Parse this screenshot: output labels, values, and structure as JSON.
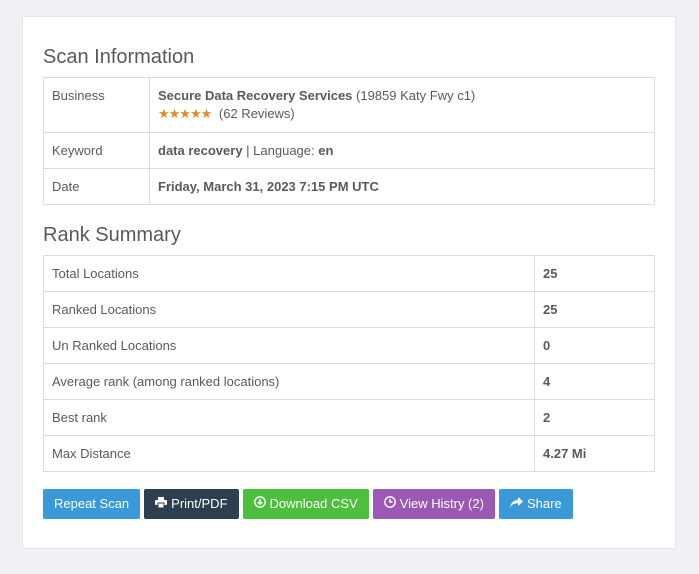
{
  "scan_info": {
    "title": "Scan Information",
    "business_label": "Business",
    "business_name": "Secure Data Recovery Services",
    "business_address": "(19859 Katy Fwy c1)",
    "rating_stars": "★★★★★",
    "reviews": "(62 Reviews)",
    "keyword_label": "Keyword",
    "keyword": "data recovery",
    "language_sep": " | Language: ",
    "language": "en",
    "date_label": "Date",
    "date": "Friday, March 31, 2023 7:15 PM UTC"
  },
  "rank_summary": {
    "title": "Rank Summary",
    "rows": [
      {
        "label": "Total Locations",
        "value": "25"
      },
      {
        "label": "Ranked Locations",
        "value": "25"
      },
      {
        "label": "Un Ranked Locations",
        "value": "0"
      },
      {
        "label": "Average rank (among ranked locations)",
        "value": "4"
      },
      {
        "label": "Best rank",
        "value": "2"
      },
      {
        "label": "Max Distance",
        "value": "4.27 Mi"
      }
    ]
  },
  "buttons": {
    "repeat_scan": "Repeat Scan",
    "print_pdf": "Print/PDF",
    "download_csv": "Download CSV",
    "view_history": "View Histry (2)",
    "share": "Share"
  },
  "colors": {
    "repeat": "#3a9ad9",
    "print": "#2c3e50",
    "download": "#4cc03c",
    "history": "#9b59b6",
    "share": "#3a9ad9",
    "star": "#e0892b"
  },
  "icons": {
    "print": "print-icon",
    "download": "download-icon",
    "history": "clock-icon",
    "share": "share-icon"
  }
}
